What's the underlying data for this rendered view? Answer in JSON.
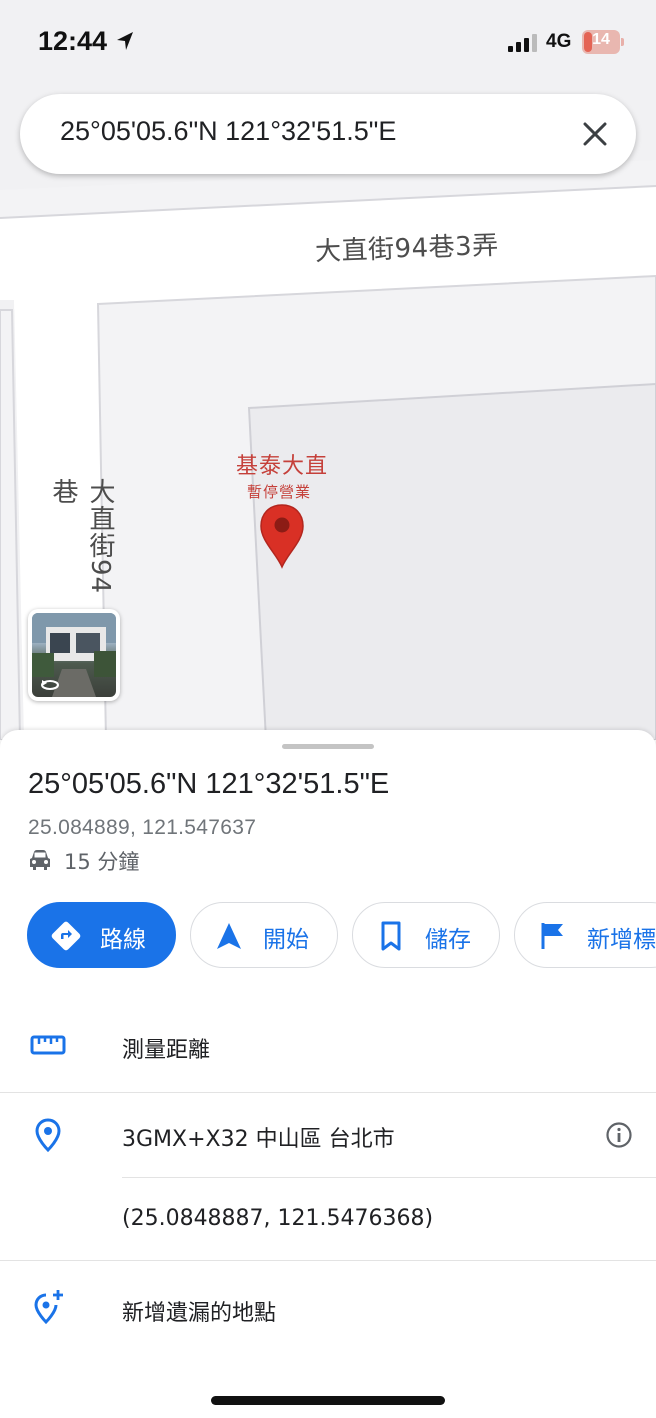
{
  "status_bar": {
    "time": "12:44",
    "network": "4G",
    "battery": "14",
    "icons": [
      "location-arrow-icon",
      "signal-icon",
      "battery-icon"
    ]
  },
  "search": {
    "query": "25°05'05.6\"N 121°32'51.5\"E",
    "clear_icon": "close-icon"
  },
  "map": {
    "street_horizontal": "大直街94巷3弄",
    "street_vertical": "大直街94巷",
    "poi_name": "基泰大直",
    "poi_status": "暫停營業",
    "pin_icon": "map-pin-icon",
    "streetview_icon": "streetview-thumbnail"
  },
  "place": {
    "title": "25°05'05.6\"N 121°32'51.5\"E",
    "decimal_coords": "25.084889, 121.547637",
    "drive_time": "15 分鐘"
  },
  "actions": [
    {
      "label": "路線",
      "icon": "directions-icon"
    },
    {
      "label": "開始",
      "icon": "navigation-arrow-icon"
    },
    {
      "label": "儲存",
      "icon": "bookmark-icon"
    },
    {
      "label": "新增標",
      "icon": "flag-icon"
    }
  ],
  "rows": {
    "measure": {
      "label": "測量距離",
      "icon": "ruler-icon"
    },
    "plus_code": {
      "label": "3GMX+X32 中山區 台北市",
      "icon": "location-pin-icon",
      "info_icon": "info-icon"
    },
    "precise_coords": {
      "label": "(25.0848887, 121.5476368)"
    },
    "add_place": {
      "label": "新增遺漏的地點",
      "icon": "add-location-icon"
    }
  },
  "colors": {
    "accent": "#1a73e8",
    "pin": "#d93025",
    "poi_text": "#c5403a",
    "map_bg": "#f1f1f3"
  }
}
